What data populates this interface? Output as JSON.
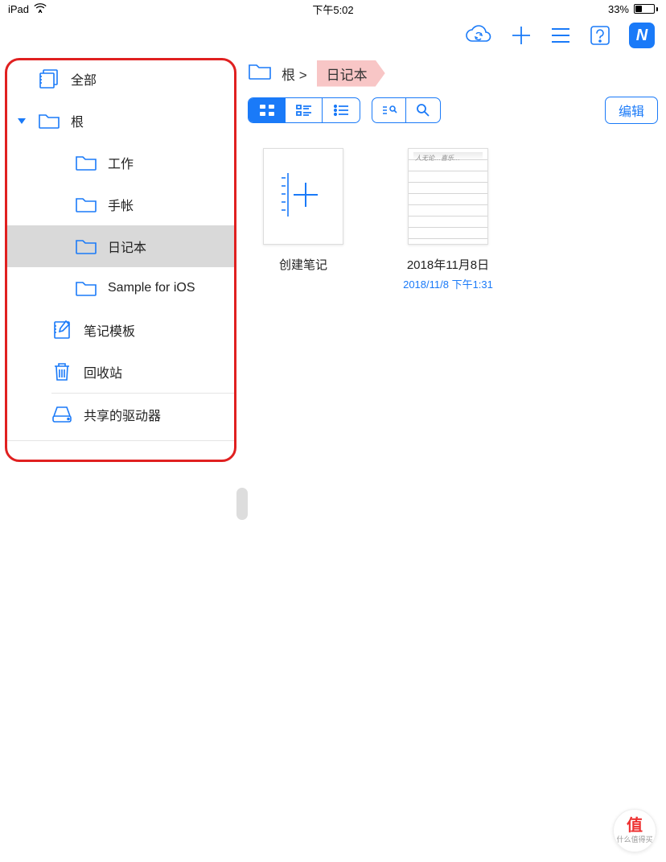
{
  "status": {
    "device": "iPad",
    "time": "下午5:02",
    "battery_pct": "33%"
  },
  "toolbar": {
    "edit_label": "编辑"
  },
  "sidebar": {
    "all_label": "全部",
    "root_label": "根",
    "items": [
      "工作",
      "手帐",
      "日记本",
      "Sample for iOS"
    ],
    "templates_label": "笔记模板",
    "trash_label": "回收站",
    "shared_label": "共享的驱动器",
    "selected_index": 2
  },
  "breadcrumb": {
    "root": "根",
    "sep": ">",
    "current": "日记本"
  },
  "notes": {
    "create_label": "创建笔记",
    "items": [
      {
        "title": "2018年11月8日",
        "date": "2018/11/8 下午1:31"
      }
    ]
  },
  "watermark": {
    "char": "值",
    "text": "什么值得买"
  }
}
